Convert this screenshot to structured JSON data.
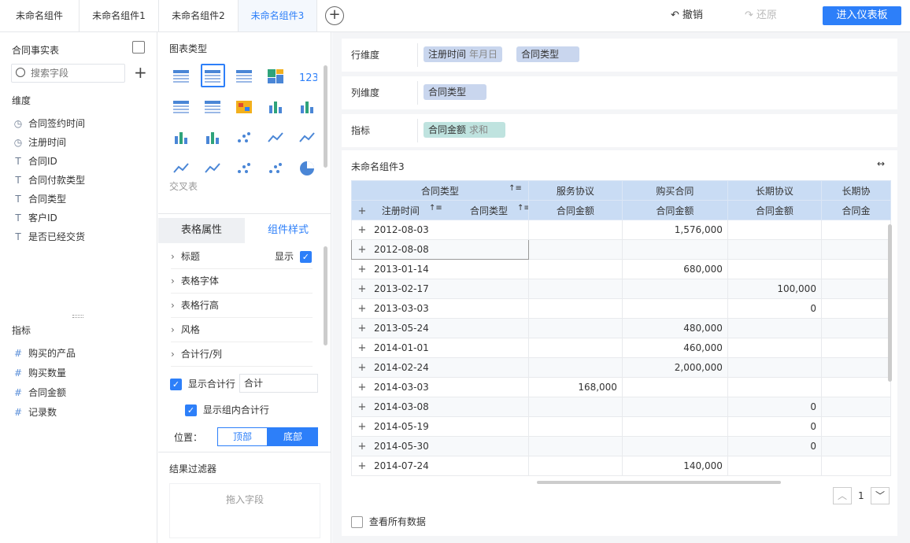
{
  "tabs": [
    "未命名组件",
    "未命名组件1",
    "未命名组件2",
    "未命名组件3"
  ],
  "active_tab_index": 3,
  "toolbar": {
    "undo": "撤销",
    "redo": "还原",
    "enter": "进入仪表板"
  },
  "left": {
    "table_name": "合同事实表",
    "search_placeholder": "搜索字段",
    "dim_title": "维度",
    "dimensions": [
      {
        "icon": "clock-icon",
        "label": "合同签约时间"
      },
      {
        "icon": "clock-icon",
        "label": "注册时间"
      },
      {
        "icon": "text-icon",
        "label": "合同ID"
      },
      {
        "icon": "text-icon",
        "label": "合同付款类型"
      },
      {
        "icon": "text-icon",
        "label": "合同类型"
      },
      {
        "icon": "text-icon",
        "label": "客户ID"
      },
      {
        "icon": "text-icon",
        "label": "是否已经交货"
      }
    ],
    "measure_title": "指标",
    "measures": [
      {
        "icon": "number-icon",
        "label": "购买的产品"
      },
      {
        "icon": "number-icon",
        "label": "购买数量"
      },
      {
        "icon": "number-icon",
        "label": "合同金额"
      },
      {
        "icon": "number-icon",
        "label": "记录数"
      }
    ]
  },
  "mid": {
    "chart_type_title": "图表类型",
    "chart_hint": "交叉表",
    "tab_table_props": "表格属性",
    "tab_component_style": "组件样式",
    "show_label": "显示",
    "sections": [
      "标题",
      "表格字体",
      "表格行高",
      "风格",
      "合计行/列"
    ],
    "show_total_row": "显示合计行",
    "total_value": "合计",
    "show_group_total": "显示组内合计行",
    "position_label": "位置：",
    "pos_top": "顶部",
    "pos_bottom": "底部",
    "filter_title": "结果过滤器",
    "drag_field": "拖入字段"
  },
  "right": {
    "row_dim_label": "行维度",
    "row_pills": [
      {
        "text": "注册时间",
        "sub": "年月日"
      },
      {
        "text": "合同类型",
        "sub": ""
      }
    ],
    "col_dim_label": "列维度",
    "col_pills": [
      {
        "text": "合同类型",
        "sub": ""
      }
    ],
    "metric_label": "指标",
    "metric_pills": [
      {
        "text": "合同金额",
        "sub": "求和"
      }
    ],
    "component_title": "未命名组件3",
    "header1": {
      "group": "合同类型",
      "cols": [
        "服务协议",
        "购买合同",
        "长期协议",
        "长期协"
      ]
    },
    "header2": {
      "h_time": "注册时间",
      "h_type": "合同类型",
      "cols": [
        "合同金额",
        "合同金额",
        "合同金额",
        "合同金"
      ]
    },
    "rows": [
      {
        "date": "2012-08-03",
        "c1": "",
        "c2": "1,576,000",
        "c3": ""
      },
      {
        "date": "2012-08-08",
        "c1": "",
        "c2": "",
        "c3": ""
      },
      {
        "date": "2013-01-14",
        "c1": "",
        "c2": "680,000",
        "c3": ""
      },
      {
        "date": "2013-02-17",
        "c1": "",
        "c2": "",
        "c3": "100,000"
      },
      {
        "date": "2013-03-03",
        "c1": "",
        "c2": "",
        "c3": "0"
      },
      {
        "date": "2013-05-24",
        "c1": "",
        "c2": "480,000",
        "c3": ""
      },
      {
        "date": "2014-01-01",
        "c1": "",
        "c2": "460,000",
        "c3": ""
      },
      {
        "date": "2014-02-24",
        "c1": "",
        "c2": "2,000,000",
        "c3": ""
      },
      {
        "date": "2014-03-03",
        "c1": "168,000",
        "c2": "",
        "c3": ""
      },
      {
        "date": "2014-03-08",
        "c1": "",
        "c2": "",
        "c3": "0"
      },
      {
        "date": "2014-05-19",
        "c1": "",
        "c2": "",
        "c3": "0"
      },
      {
        "date": "2014-05-30",
        "c1": "",
        "c2": "",
        "c3": "0"
      },
      {
        "date": "2014-07-24",
        "c1": "",
        "c2": "140,000",
        "c3": ""
      }
    ],
    "page_num": "1",
    "view_all": "查看所有数据"
  }
}
